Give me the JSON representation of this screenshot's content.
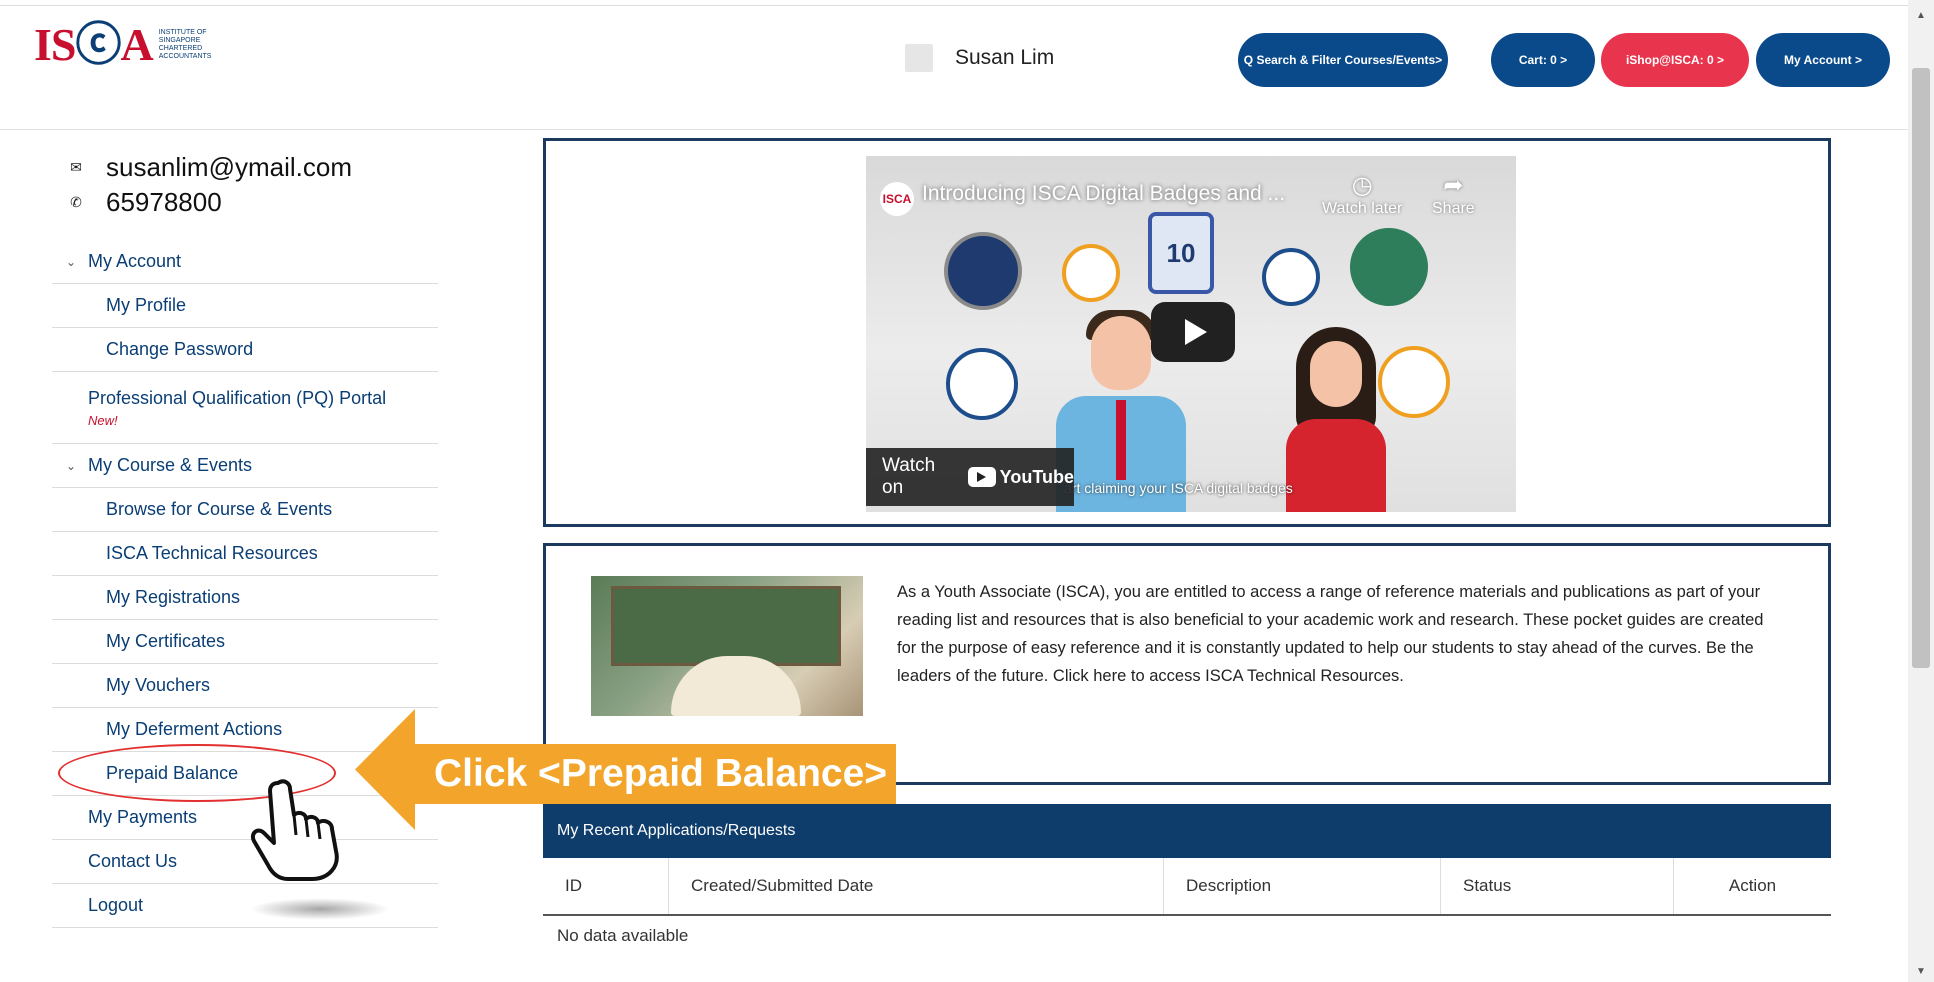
{
  "header": {
    "logo_mark": "ISCA",
    "logo_text": "Institute of Singapore Chartered Accountants",
    "user_name": "Susan Lim",
    "buttons": {
      "search": "Q Search & Filter Courses/Events>",
      "cart": "Cart: 0 >",
      "ishop": "iShop@ISCA: 0 >",
      "account": "My Account >"
    },
    "colors": {
      "primary_button": "#0a4a8a",
      "ishop_button": "#e8344c"
    }
  },
  "contact": {
    "email": "susanlim@ymail.com",
    "phone": "65978800"
  },
  "menu": {
    "my_account": "My Account",
    "my_profile": "My Profile",
    "change_password": "Change Password",
    "pq_portal": "Professional Qualification (PQ) Portal",
    "new_tag": "New!",
    "my_course_events": "My Course & Events",
    "browse": "Browse for Course & Events",
    "technical_resources": "ISCA Technical Resources",
    "registrations": "My Registrations",
    "certificates": "My Certificates",
    "vouchers": "My Vouchers",
    "deferment": "My Deferment Actions",
    "prepaid_balance": "Prepaid Balance",
    "payments": "My Payments",
    "contact_us": "Contact Us",
    "logout": "Logout"
  },
  "video": {
    "title": "Introducing ISCA Digital Badges and ...",
    "watch_later": "Watch later",
    "share": "Share",
    "watch_on": "Watch on",
    "youtube": "YouTube",
    "caption": "art claiming your ISCA digital badges",
    "badge_center": "10"
  },
  "info": {
    "text": "As a Youth Associate (ISCA), you are entitled to access a range of reference materials and publications as part of your reading list and resources that is also beneficial to your academic work and research. These pocket guides are created for the purpose of easy reference and it is constantly updated to help our students to stay ahead of the curves. Be the leaders of the future. Click here to access ISCA Technical Resources."
  },
  "applications": {
    "title": "My Recent Applications/Requests",
    "columns": [
      "ID",
      "Created/Submitted Date",
      "Description",
      "Status",
      "Action"
    ],
    "empty": "No data available"
  },
  "callout": {
    "text": "Click <Prepaid Balance>",
    "color": "#f2a52a"
  }
}
